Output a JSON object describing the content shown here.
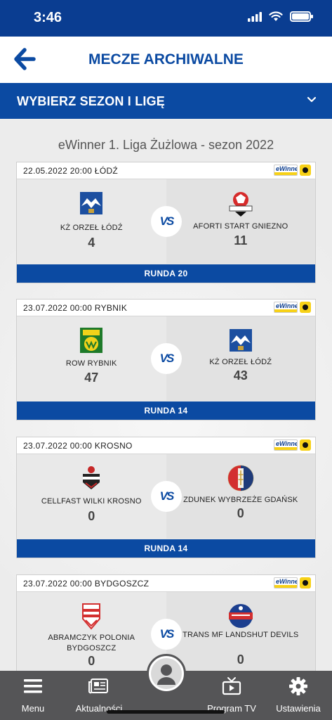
{
  "status": {
    "time": "3:46"
  },
  "header": {
    "title": "MECZE ARCHIWALNE"
  },
  "season_bar": {
    "label": "WYBIERZ SEZON I LIGĘ"
  },
  "league": {
    "title": "eWinner 1. Liga Żużlowa - sezon 2022",
    "sponsor_text": "eWinner"
  },
  "vs_label": "VS",
  "matches": [
    {
      "date": "22.05.2022 20:00 ŁÓDŹ",
      "home": {
        "name": "KŻ ORZEŁ ŁÓDŹ",
        "score": "4"
      },
      "away": {
        "name": "AFORTI START GNIEZNO",
        "score": "11"
      },
      "round": "RUNDA 20"
    },
    {
      "date": "23.07.2022 00:00 RYBNIK",
      "home": {
        "name": "ROW RYBNIK",
        "score": "47"
      },
      "away": {
        "name": "KŻ ORZEŁ ŁÓDŹ",
        "score": "43"
      },
      "round": "RUNDA 14"
    },
    {
      "date": "23.07.2022 00:00 KROSNO",
      "home": {
        "name": "CELLFAST WILKI KROSNO",
        "score": "0"
      },
      "away": {
        "name": "ZDUNEK WYBRZEŻE GDAŃSK",
        "score": "0"
      },
      "round": "RUNDA 14"
    },
    {
      "date": "23.07.2022 00:00 BYDGOSZCZ",
      "home": {
        "name": "ABRAMCZYK POLONIA BYDGOSZCZ",
        "score": "0"
      },
      "away": {
        "name": "TRANS MF LANDSHUT DEVILS",
        "score": "0"
      },
      "round": ""
    }
  ],
  "nav": [
    {
      "label": "Menu",
      "icon": "menu-icon"
    },
    {
      "label": "Aktualności",
      "icon": "news-icon"
    },
    {
      "label": "",
      "icon": "profile-icon"
    },
    {
      "label": "Program TV",
      "icon": "tv-icon"
    },
    {
      "label": "Ustawienia",
      "icon": "gear-icon"
    }
  ],
  "colors": {
    "primary": "#0b4aa2",
    "status_bar": "#0a3d91",
    "nav_bg": "#555557"
  }
}
